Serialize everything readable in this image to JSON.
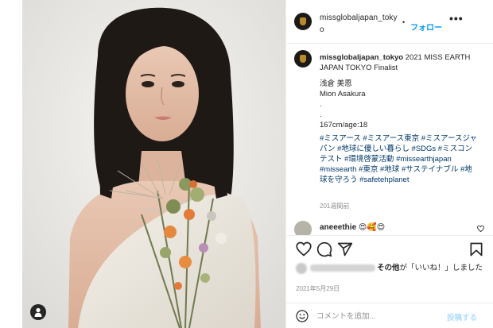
{
  "post": {
    "username": "missglobaljapan_tokyo",
    "follow_label": "フォロー",
    "more_label": "•••",
    "caption_user": "missglobaljapan_tokyo",
    "caption_title": "2021 MISS EARTH JAPAN TOKYO Finalist",
    "caption_name_jp": "浅倉 美恩",
    "caption_name_en": "Mion Asakura",
    "caption_dot1": ".",
    "caption_dot2": ".",
    "caption_stats": "167cm/age:18",
    "caption_tags": "#ミスアース #ミスアース東京 #ミスアースジャパン #地球に優しい暮らし #SDGs #ミスコンテスト #環境啓蒙活動 #missearthjapan #missearth #東京 #地球 #サステイナブル #地球を守ろう #safetehplanet",
    "time_ago": "201週間前"
  },
  "comment": {
    "username": "aneeethie",
    "text": "😍🥰😍"
  },
  "likes": {
    "suffix_bold": "その他",
    "suffix_text": "が「いいね！」しました"
  },
  "date": "2021年5月29日",
  "add_comment": {
    "placeholder": "コメントを追加...",
    "post_label": "投稿する"
  },
  "icons": {
    "heart": "heart-icon",
    "comment": "comment-icon",
    "share": "share-icon",
    "save": "bookmark-icon",
    "emoji": "emoji-icon",
    "user_tag": "user-tag-icon",
    "more": "more-icon"
  },
  "colors": {
    "link_blue": "#0095f6",
    "hashtag": "#00376b",
    "muted": "#8e8e8e",
    "border": "#efefef"
  }
}
